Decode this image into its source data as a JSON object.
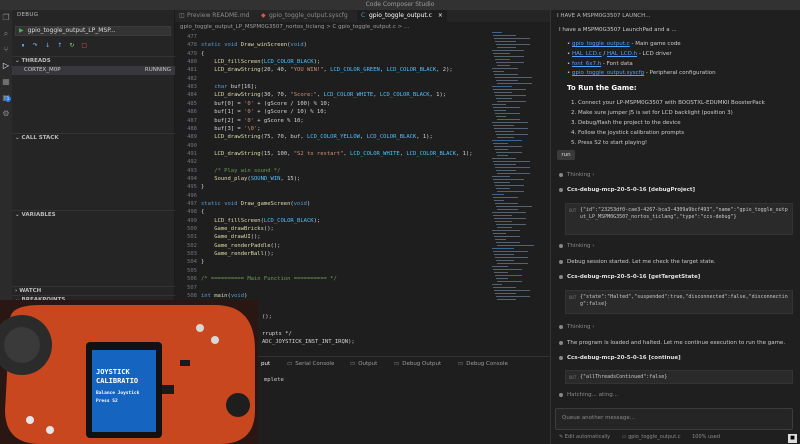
{
  "app": {
    "title": "Code Composer Studio"
  },
  "sidebar": {
    "title": "DEBUG",
    "launch_config": "gpio_toggle_output_LP_MSP...",
    "threads_label": "THREADS",
    "thread_name": "CORTEX_M0P",
    "thread_status": "RUNNING",
    "call_stack_label": "CALL STACK",
    "variables_label": "VARIABLES",
    "watch_label": "WATCH",
    "breakpoints_label": "BREAKPOINTS"
  },
  "tabs": [
    {
      "label": "Preview README.md",
      "icon": "preview-icon"
    },
    {
      "label": "gpio_toggle_output.syscfg",
      "icon": "syscfg-icon"
    },
    {
      "label": "gpio_toggle_output.c",
      "icon": "c-file-icon",
      "close": "×"
    }
  ],
  "breadcrumb": "gpio_toggle_output_LP_MSPM0G3507_nortos_ticlang  >  C  gpio_toggle_output.c  >  ...",
  "editor": {
    "lines": [
      {
        "n": "477",
        "t": ""
      },
      {
        "n": "478",
        "t": "static void Draw_winScreen(void)"
      },
      {
        "n": "479",
        "t": "{"
      },
      {
        "n": "480",
        "t": "    LCD_fillScreen(LCD_COLOR_BLACK);"
      },
      {
        "n": "481",
        "t": "    LCD_drawString(20, 40, \"YOU WIN!\", LCD_COLOR_GREEN, LCD_COLOR_BLACK, 2);"
      },
      {
        "n": "482",
        "t": ""
      },
      {
        "n": "483",
        "t": "    char buf[16];"
      },
      {
        "n": "484",
        "t": "    LCD_drawString(30, 70, \"Score:\", LCD_COLOR_WHITE, LCD_COLOR_BLACK, 1);"
      },
      {
        "n": "485",
        "t": "    buf[0] = '0' + (gScore / 100) % 10;"
      },
      {
        "n": "486",
        "t": "    buf[1] = '0' + (gScore / 10) % 10;"
      },
      {
        "n": "487",
        "t": "    buf[2] = '0' + gScore % 10;"
      },
      {
        "n": "488",
        "t": "    buf[3] = '\\0';"
      },
      {
        "n": "489",
        "t": "    LCD_drawString(75, 70, buf, LCD_COLOR_YELLOW, LCD_COLOR_BLACK, 1);"
      },
      {
        "n": "490",
        "t": ""
      },
      {
        "n": "491",
        "t": "    LCD_drawString(15, 100, \"S2 to restart\", LCD_COLOR_WHITE, LCD_COLOR_BLACK, 1);"
      },
      {
        "n": "492",
        "t": ""
      },
      {
        "n": "493",
        "t": "    /* Play win sound */"
      },
      {
        "n": "494",
        "t": "    Sound_play(SOUND_WIN, 15);"
      },
      {
        "n": "495",
        "t": "}"
      },
      {
        "n": "496",
        "t": ""
      },
      {
        "n": "497",
        "t": "static void Draw_gameScreen(void)"
      },
      {
        "n": "498",
        "t": "{"
      },
      {
        "n": "499",
        "t": "    LCD_fillScreen(LCD_COLOR_BLACK);"
      },
      {
        "n": "500",
        "t": "    Game_drawBricks();"
      },
      {
        "n": "501",
        "t": "    Game_drawUI();"
      },
      {
        "n": "502",
        "t": "    Game_renderPaddle();"
      },
      {
        "n": "503",
        "t": "    Game_renderBall();"
      },
      {
        "n": "504",
        "t": "}"
      },
      {
        "n": "505",
        "t": ""
      },
      {
        "n": "506",
        "t": "/* ========== Main Function ========== */"
      },
      {
        "n": "507",
        "t": ""
      },
      {
        "n": "508",
        "t": "int main(void)"
      }
    ],
    "tail_lines": [
      {
        "t": "();"
      },
      {
        "t": ""
      },
      {
        "t": "rrupts */"
      },
      {
        "t": "ADC_JOYSTICK_INST_INT_IRQN);"
      }
    ]
  },
  "panel": {
    "tabs": [
      {
        "label": "Serial Console"
      },
      {
        "label": "Output"
      },
      {
        "label": "Debug Output"
      },
      {
        "label": "Debug Console"
      }
    ],
    "active_prefix": "put",
    "text": "mplete"
  },
  "photo": {
    "screen_lines": [
      "JOYSTICK",
      "CALIBRATIO",
      "Balance Joystick",
      "Press S2"
    ]
  },
  "chat": {
    "header": "I HAVE A MSPM0G3507 LAUNCH...",
    "intro": "I have a MSPM0G3507 LaunchPad and a ...",
    "files": [
      {
        "name": "gpio_toggle_output.c",
        "desc": " - Main game code"
      },
      {
        "name": "HAL_LCD.c",
        "name2": "HAL_LCD.h",
        "desc": " - LCD driver"
      },
      {
        "name": "font_6x7.h",
        "desc": " - Font data"
      },
      {
        "name": "gpio_toggle_output.syscfg",
        "desc": " - Peripheral configuration"
      }
    ],
    "run_heading": "To Run the Game:",
    "steps": [
      "1. Connect your LP-MSPM0G3507 with BOOSTXL-EDUMKII BoosterPack",
      "2. Make sure jumper J5 is set for LCD backlight (position 3)",
      "3. Debug/flash the project to the device",
      "4. Follow the joystick calibration prompts",
      "5. Press S2 to start playing!"
    ],
    "run_msg": "run",
    "thinking": "Thinking",
    "tool1": "Ccs-debug-mcp-20-5-0-16 [debugProject]",
    "tool1_out": "{\"id\":\"23253df0-cae3-4267-bca3-4309a9bcf493\",\"name\":\"gpio_toggle_output_LP_MSPM0G3507_nortos_ticlang\",\"type\":\"ccs-debug\"}",
    "msg1": "Debug session started. Let me check the target state.",
    "tool2": "Ccs-debug-mcp-20-5-0-16 [getTargetState]",
    "tool2_out": "{\"state\":\"Halted\",\"suspended\":true,\"disconnected\":false,\"disconnecting\":false}",
    "msg2": "The program is loaded and halted. Let me continue execution to run the game.",
    "tool3": "Ccs-debug-mcp-20-5-0-16 [continue]",
    "tool3_out": "{\"allThreadsContinued\":false}",
    "status": "Hatching... ating...",
    "out_label": "OUT",
    "input_placeholder": "Queue another message...",
    "footer_mode": "Edit automatically",
    "footer_file": "gpio_toggle_output.c",
    "footer_usage": "100% used",
    "send_label": "■"
  }
}
